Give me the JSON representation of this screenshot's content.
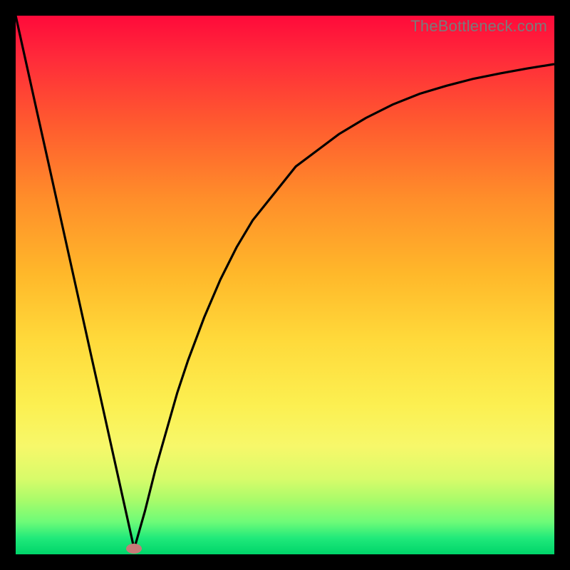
{
  "watermark": "TheBottleneck.com",
  "colors": {
    "frame_border": "#000000",
    "curve_stroke": "#000000",
    "marker_fill": "#c77a78"
  },
  "chart_data": {
    "type": "line",
    "title": "",
    "xlabel": "",
    "ylabel": "",
    "xlim": [
      0,
      100
    ],
    "ylim": [
      0,
      100
    ],
    "grid": false,
    "marker": {
      "x": 22,
      "y": 1
    },
    "series": [
      {
        "name": "curve",
        "x": [
          0,
          2,
          4,
          6,
          8,
          10,
          12,
          14,
          16,
          18,
          20,
          22,
          24,
          26,
          28,
          30,
          32,
          35,
          38,
          41,
          44,
          48,
          52,
          56,
          60,
          65,
          70,
          75,
          80,
          85,
          90,
          95,
          100
        ],
        "y": [
          100,
          91,
          82,
          73,
          64,
          55,
          46,
          37,
          28,
          19,
          10,
          1,
          8,
          16,
          23,
          30,
          36,
          44,
          51,
          57,
          62,
          67,
          72,
          75,
          78,
          81,
          83.5,
          85.5,
          87,
          88.3,
          89.3,
          90.2,
          91
        ]
      }
    ]
  }
}
